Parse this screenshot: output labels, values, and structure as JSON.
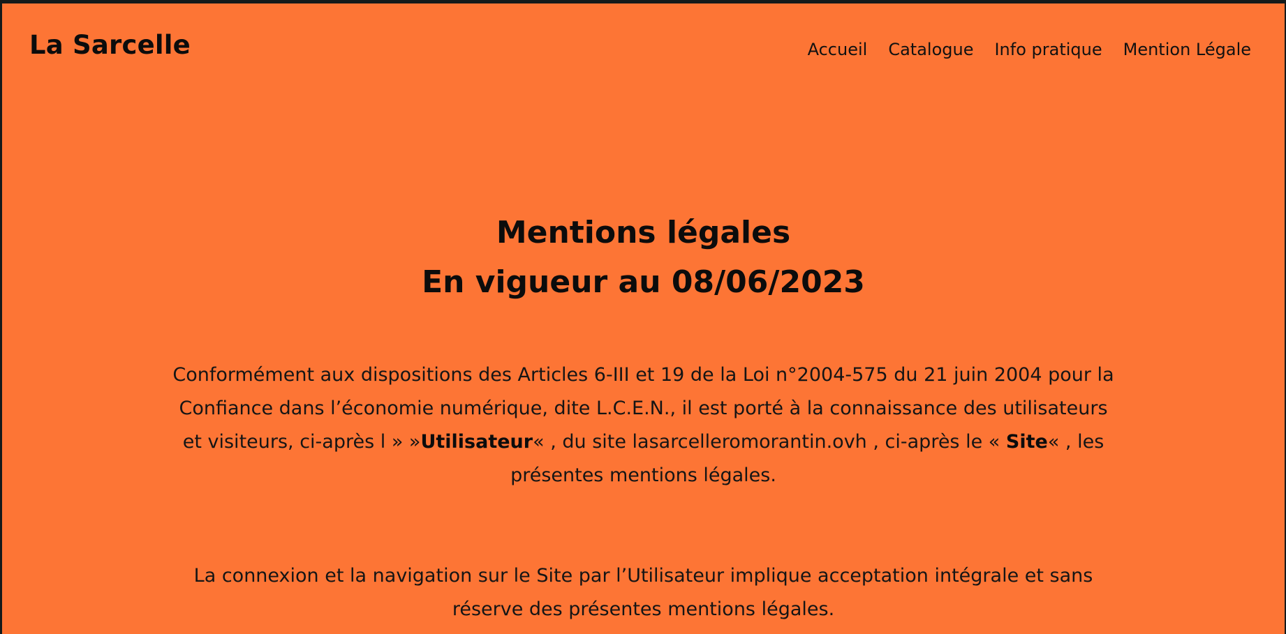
{
  "header": {
    "brand": "La Sarcelle",
    "nav": [
      {
        "label": "Accueil"
      },
      {
        "label": "Catalogue"
      },
      {
        "label": "Info pratique"
      },
      {
        "label": "Mention Légale"
      }
    ]
  },
  "content": {
    "title_line1": "Mentions légales",
    "title_line2": "En vigueur au 08/06/2023",
    "paragraph1": {
      "part1": "Conformément aux dispositions des Articles 6-III et 19 de la Loi n°2004-575 du 21 juin 2004 pour la Confiance dans l’économie numérique, dite L.C.E.N., il est porté à la connaissance des utilisateurs et visiteurs, ci-après l » »",
      "strong1": "Utilisateur",
      "part2": "« , du site lasarcelleromorantin.ovh , ci-après le « ",
      "strong2": "Site",
      "part3": "« , les présentes mentions légales."
    },
    "paragraph2": "La connexion et la navigation sur le Site par l’Utilisateur implique acceptation intégrale et sans réserve des présentes mentions légales."
  },
  "colors": {
    "background": "#fd7535",
    "window_border": "#141a1a",
    "text": "#111111"
  }
}
